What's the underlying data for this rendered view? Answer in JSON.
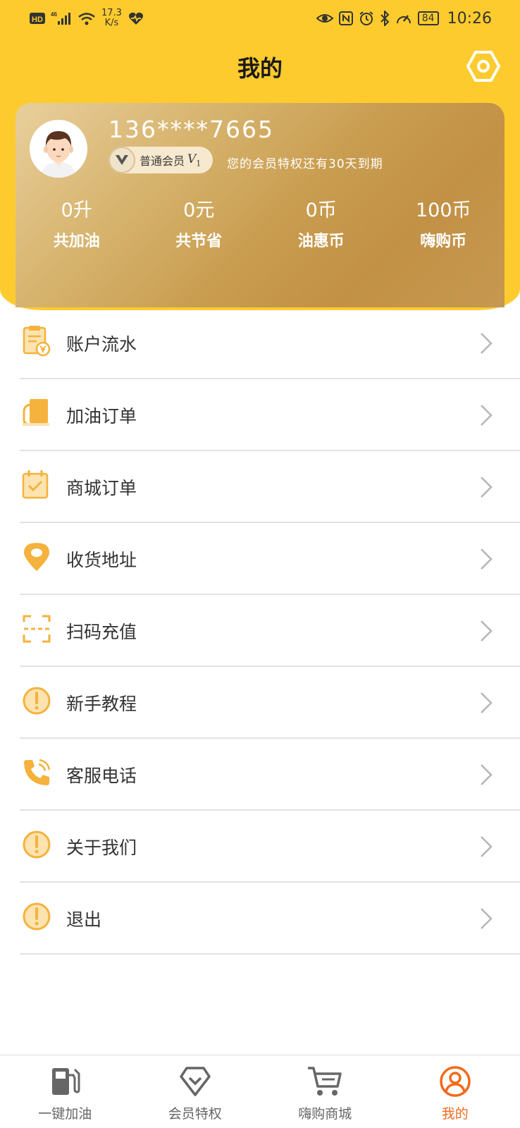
{
  "status_bar": {
    "network_speed": "17.3",
    "network_speed_unit": "K/s",
    "battery": "84",
    "time": "10:26"
  },
  "header": {
    "title": "我的",
    "settings_icon": "hexagon-settings-icon"
  },
  "member_card": {
    "phone": "136****7665",
    "level_name": "普通会员",
    "level_code": "V",
    "level_num": "1",
    "expire_note": "您的会员特权还有30天到期",
    "stats": [
      {
        "value": "0升",
        "label": "共加油"
      },
      {
        "value": "0元",
        "label": "共节省"
      },
      {
        "value": "0币",
        "label": "油惠币"
      },
      {
        "value": "100币",
        "label": "嗨购币"
      }
    ]
  },
  "menu": [
    {
      "label": "账户流水",
      "icon": "account-statement-icon"
    },
    {
      "label": "加油订单",
      "icon": "fuel-order-icon"
    },
    {
      "label": "商城订单",
      "icon": "calendar-check-icon"
    },
    {
      "label": "收货地址",
      "icon": "location-pin-icon"
    },
    {
      "label": "扫码充值",
      "icon": "scan-icon"
    },
    {
      "label": "新手教程",
      "icon": "exclamation-circle-icon"
    },
    {
      "label": "客服电话",
      "icon": "phone-icon"
    },
    {
      "label": "关于我们",
      "icon": "exclamation-circle-icon"
    },
    {
      "label": "退出",
      "icon": "exclamation-circle-icon"
    }
  ],
  "tabbar": [
    {
      "label": "一键加油",
      "icon": "fuel-pump-icon"
    },
    {
      "label": "会员特权",
      "icon": "diamond-icon"
    },
    {
      "label": "嗨购商城",
      "icon": "cart-icon"
    },
    {
      "label": "我的",
      "icon": "user-circle-icon",
      "active": true
    }
  ],
  "colors": {
    "brand_yellow": "#FDCB2E",
    "icon_orange": "#F5B23C",
    "active_tab": "#F26A1B"
  }
}
